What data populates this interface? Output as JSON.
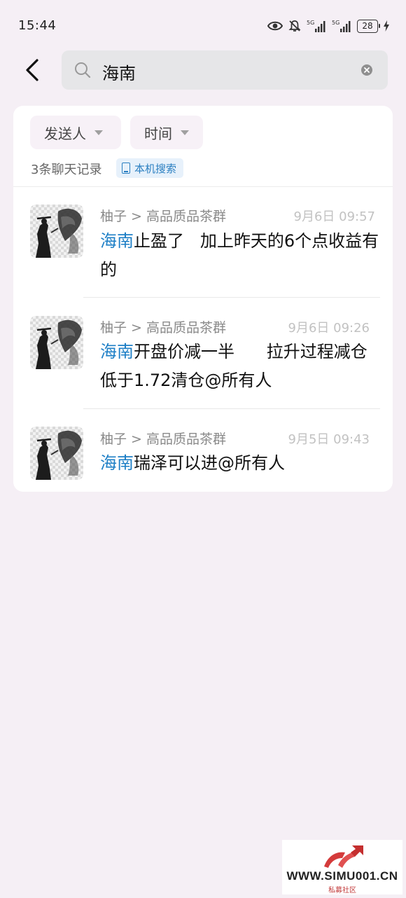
{
  "status_bar": {
    "time": "15:44",
    "battery": "28",
    "signal_1": "5G",
    "signal_2": "5G"
  },
  "search": {
    "query": "海南"
  },
  "filters": {
    "sender_label": "发送人",
    "time_label": "时间"
  },
  "summary": {
    "count_text": "3条聊天记录",
    "local_search_label": "本机搜索"
  },
  "results": [
    {
      "source": "柚子 > 高品质品茶群",
      "time": "9月6日 09:57",
      "keyword": "海南",
      "rest": "止盈了   加上昨天的6个点收益有的"
    },
    {
      "source": "柚子 > 高品质品茶群",
      "time": "9月6日 09:26",
      "keyword": "海南",
      "rest": "开盘价减一半      拉升过程减仓      低于1.72清仓@所有人"
    },
    {
      "source": "柚子 > 高品质品茶群",
      "time": "9月5日 09:43",
      "keyword": "海南",
      "rest": "瑞泽可以进@所有人"
    }
  ],
  "watermark": {
    "text": "WWW.SIMU001.CN",
    "subtext": "私募社区"
  },
  "colors": {
    "highlight": "#1e7fc6",
    "background": "#f5eff5",
    "badge_bg": "#e7f1fb"
  },
  "icons": [
    "back-arrow-icon",
    "search-icon",
    "clear-icon",
    "eye-icon",
    "mute-bell-icon",
    "signal-icon",
    "battery-icon",
    "charging-icon",
    "caret-down-icon",
    "phone-icon"
  ]
}
